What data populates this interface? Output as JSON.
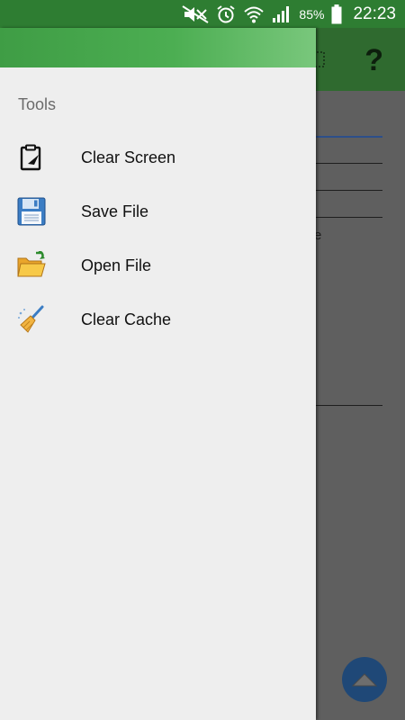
{
  "status_bar": {
    "battery_percent": "85%",
    "time": "22:23",
    "icons": [
      "mute-icon",
      "alarm-icon",
      "wifi-icon",
      "signal-icon",
      "battery-icon"
    ]
  },
  "background_app": {
    "help_glyph": "?",
    "partial_letter": "e"
  },
  "drawer": {
    "section_title": "Tools",
    "items": [
      {
        "label": "Clear Screen",
        "icon": "clipboard-icon"
      },
      {
        "label": "Save File",
        "icon": "floppy-disk-icon"
      },
      {
        "label": "Open File",
        "icon": "open-folder-icon"
      },
      {
        "label": "Clear Cache",
        "icon": "broom-icon"
      }
    ]
  },
  "colors": {
    "status_bar": "#2e7d32",
    "drawer_header": "#4cae52",
    "drawer_bg": "#eeeeee",
    "fab": "#1f4877"
  }
}
